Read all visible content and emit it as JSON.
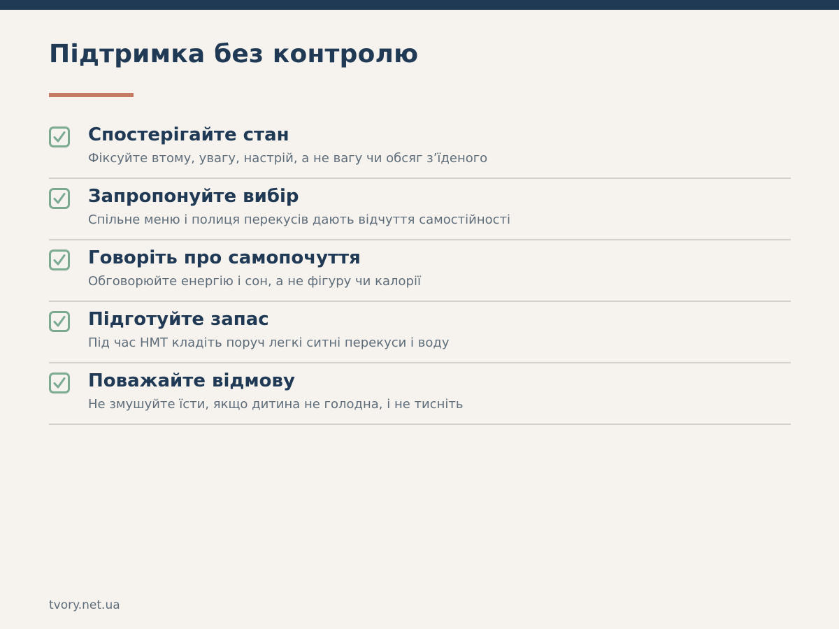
{
  "title": "Підтримка без контролю",
  "items": [
    {
      "title": "Спостерігайте стан",
      "description": "Фіксуйте втому, увагу, настрій, а не вагу чи обсяг з’їденого",
      "icon": "checkbox-checked-icon"
    },
    {
      "title": "Запропонуйте вибір",
      "description": "Спільне меню і полиця перекусів дають відчуття самостійності",
      "icon": "checkbox-checked-icon"
    },
    {
      "title": "Говоріть про самопочуття",
      "description": "Обговорюйте енергію і сон, а не фігуру чи калорії",
      "icon": "checkbox-checked-icon"
    },
    {
      "title": "Підготуйте запас",
      "description": "Під час НМТ кладіть поруч легкі ситні перекуси і воду",
      "icon": "checkbox-checked-icon"
    },
    {
      "title": "Поважайте відмову",
      "description": "Не змушуйте їсти, якщо дитина не голодна, і не тисніть",
      "icon": "checkbox-checked-icon"
    }
  ],
  "footer": "tvory.net.ua",
  "colors": {
    "background": "#f6f3ee",
    "top_bar": "#203a55",
    "heading": "#203a55",
    "accent": "#c67a63",
    "check": "#7aaa90",
    "body_text": "#5f6d7a",
    "divider": "#d4d1ca"
  }
}
